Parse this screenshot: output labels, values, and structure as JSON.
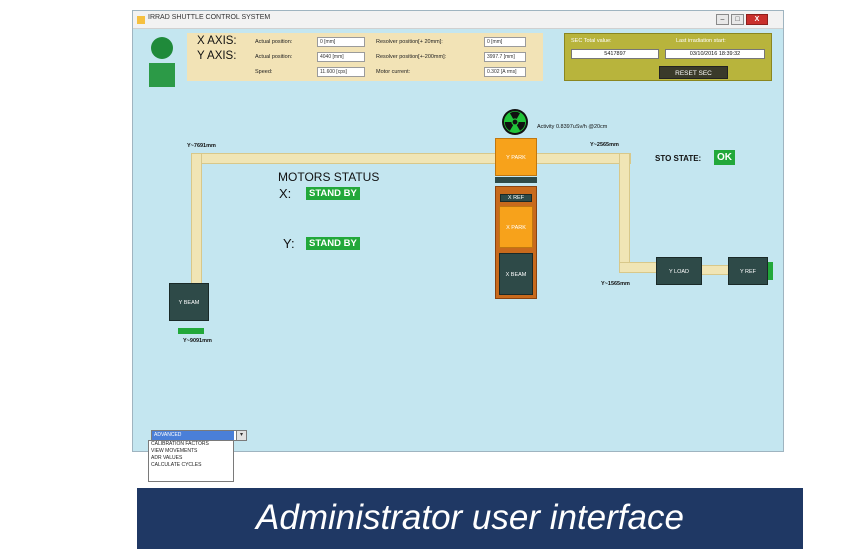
{
  "window": {
    "title": "IRRAD SHUTTLE CONTROL SYSTEM",
    "min_label": "–",
    "max_label": "□",
    "close_label": "X"
  },
  "axes": {
    "x": {
      "label": "X AXIS:",
      "actual_label": "Actual position:",
      "actual_value": "0 [mm]",
      "resolver_label": "Resolver position[+ 20mm]:",
      "resolver_value": "0 [mm]"
    },
    "y": {
      "label": "Y AXIS:",
      "actual_label": "Actual position:",
      "actual_value": "4040 [mm]",
      "resolver_label": "Resolver position[+-200mm]:",
      "resolver_value": "3997.7 [mm]"
    },
    "speed_label": "Speed:",
    "speed_value": "11.600 [cps]",
    "motor_current_label": "Motor current:",
    "motor_current_value": "0.302 [A rms]"
  },
  "sec": {
    "total_label": "SEC Total value:",
    "total_value": "5417897",
    "start_label": "Last irradiation start:",
    "start_value": "03/10/2016 18:39:32",
    "reset_label": "RESET SEC"
  },
  "activity": "Activity 0.8397uSv/h @20cm",
  "coords": {
    "y_top_left": "Y~7691mm",
    "y_top_right": "Y~2565mm",
    "y_bottom_right": "Y~1565mm",
    "y_bottom_left": "Y~9091mm"
  },
  "boxes": {
    "y_park": "Y PARK",
    "x_ref": "X REF",
    "x_park": "X PARK",
    "x_beam": "X BEAM",
    "y_beam": "Y BEAM",
    "y_load": "Y LOAD",
    "y_ref": "Y REF"
  },
  "motors": {
    "title": "MOTORS STATUS",
    "x_label": "X:",
    "x_status": "STAND BY",
    "y_label": "Y:",
    "y_status": "STAND BY"
  },
  "sto": {
    "label": "STO STATE:",
    "value": "OK"
  },
  "admin": {
    "selected": "ADVANCED",
    "arrow": "▾",
    "options": [
      "CALIBRATION FACTORS",
      "VIEW MOVEMENTS",
      "ADR VALUES",
      "CALCULATE CYCLES"
    ]
  },
  "caption": "Administrator user interface",
  "colors": {
    "window_bg": "#c4e6f0",
    "panel_tan": "#f2e3b6",
    "sec_panel": "#b8b43c",
    "status_green": "#22a83a",
    "dark_box": "#2e4a48",
    "orange_box": "#f7a21b",
    "caption_bg": "#1f3864"
  }
}
